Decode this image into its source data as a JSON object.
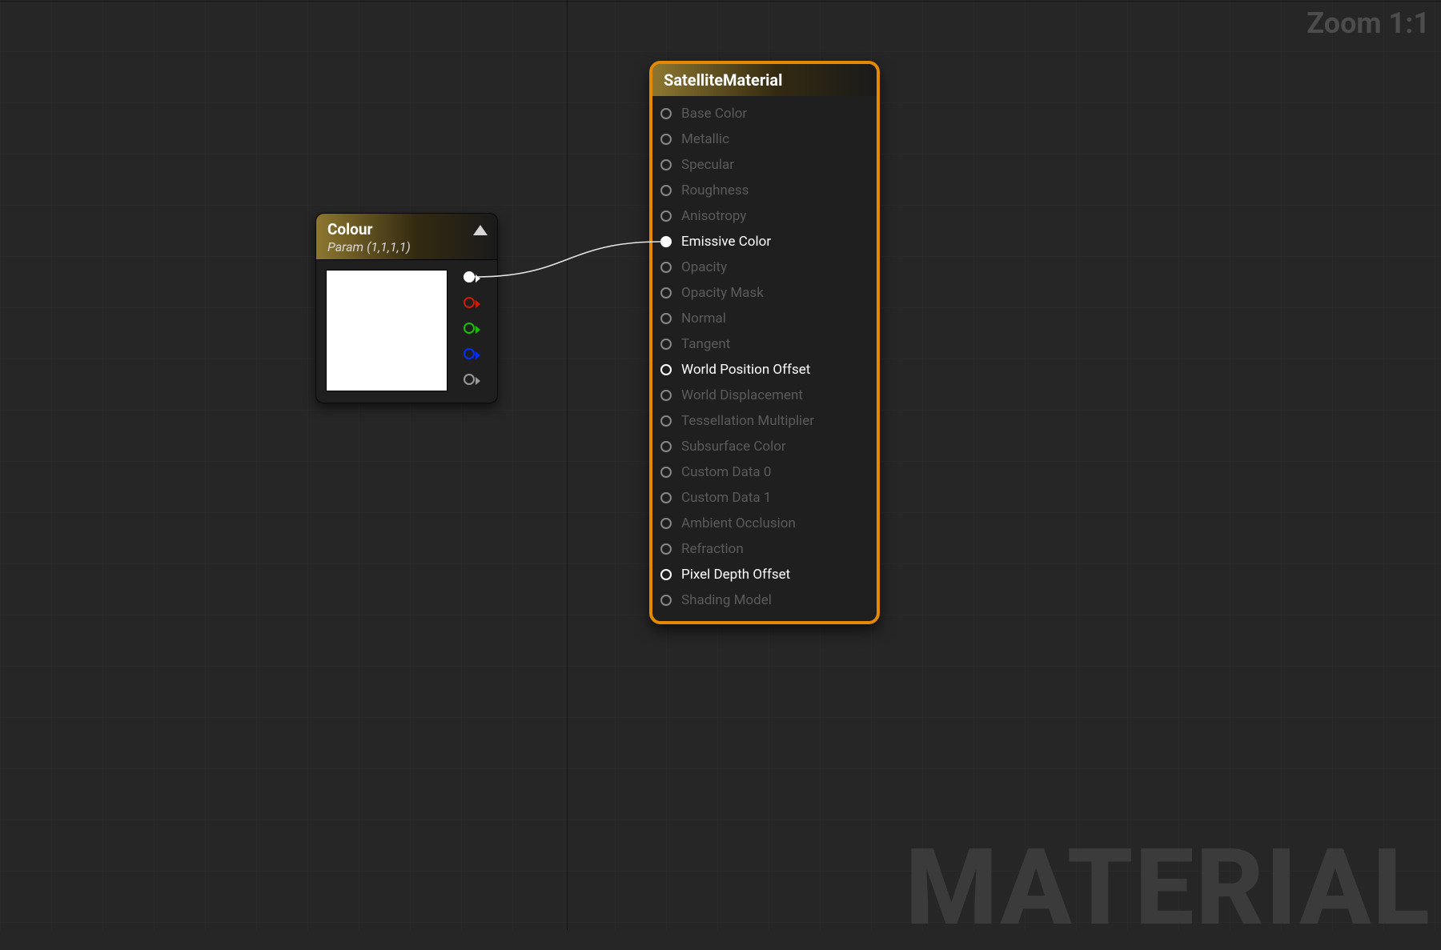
{
  "viewport": {
    "zoom_label": "Zoom 1:1",
    "watermark": "MATERIAL"
  },
  "param_node": {
    "title": "Colour",
    "subtitle": "Param (1,1,1,1)",
    "swatch_color": "#ffffff",
    "output_pins": [
      {
        "name": "rgba",
        "color": "white",
        "connected": true
      },
      {
        "name": "r",
        "color": "red",
        "connected": false
      },
      {
        "name": "g",
        "color": "green",
        "connected": false
      },
      {
        "name": "b",
        "color": "blue",
        "connected": false
      },
      {
        "name": "a",
        "color": "grey",
        "connected": false
      }
    ]
  },
  "material_node": {
    "title": "SatelliteMaterial",
    "inputs": [
      {
        "label": "Base Color",
        "active": false,
        "connected": false
      },
      {
        "label": "Metallic",
        "active": false,
        "connected": false
      },
      {
        "label": "Specular",
        "active": false,
        "connected": false
      },
      {
        "label": "Roughness",
        "active": false,
        "connected": false
      },
      {
        "label": "Anisotropy",
        "active": false,
        "connected": false
      },
      {
        "label": "Emissive Color",
        "active": true,
        "connected": true
      },
      {
        "label": "Opacity",
        "active": false,
        "connected": false
      },
      {
        "label": "Opacity Mask",
        "active": false,
        "connected": false
      },
      {
        "label": "Normal",
        "active": false,
        "connected": false
      },
      {
        "label": "Tangent",
        "active": false,
        "connected": false
      },
      {
        "label": "World Position Offset",
        "active": true,
        "connected": false
      },
      {
        "label": "World Displacement",
        "active": false,
        "connected": false
      },
      {
        "label": "Tessellation Multiplier",
        "active": false,
        "connected": false
      },
      {
        "label": "Subsurface Color",
        "active": false,
        "connected": false
      },
      {
        "label": "Custom Data 0",
        "active": false,
        "connected": false
      },
      {
        "label": "Custom Data 1",
        "active": false,
        "connected": false
      },
      {
        "label": "Ambient Occlusion",
        "active": false,
        "connected": false
      },
      {
        "label": "Refraction",
        "active": false,
        "connected": false
      },
      {
        "label": "Pixel Depth Offset",
        "active": true,
        "connected": false
      },
      {
        "label": "Shading Model",
        "active": false,
        "connected": false
      }
    ]
  }
}
